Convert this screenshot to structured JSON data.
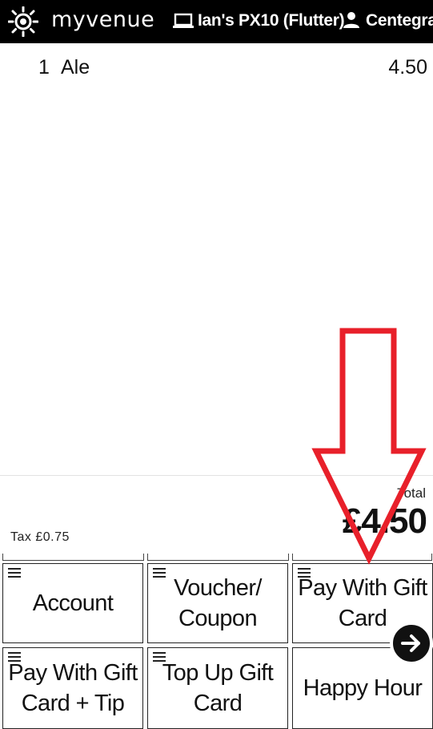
{
  "header": {
    "brand": "myvenue",
    "device_name": "Ian's PX10 (Flutter)",
    "user_name": "Centegra"
  },
  "order": {
    "lines": [
      {
        "qty": "1",
        "item": "Ale",
        "price": "4.50"
      }
    ]
  },
  "totals": {
    "total_label": "Total",
    "total_amount": "£4.50",
    "tax_label": "Tax  £0.75"
  },
  "buttons": {
    "account": "Account",
    "voucher_coupon": "Voucher/ Coupon",
    "pay_with_gift_card": "Pay With Gift Card",
    "pay_with_gift_card_tip": "Pay With Gift Card + Tip",
    "top_up_gift_card": "Top Up Gift Card",
    "happy_hour": "Happy Hour"
  },
  "colors": {
    "header_bg": "#000000",
    "annotation_arrow": "#e8202a"
  },
  "icons": {
    "logo": "sun-logo-icon",
    "device": "laptop-icon",
    "user": "person-icon",
    "menu": "hamburger-icon",
    "next": "arrow-right-icon"
  }
}
